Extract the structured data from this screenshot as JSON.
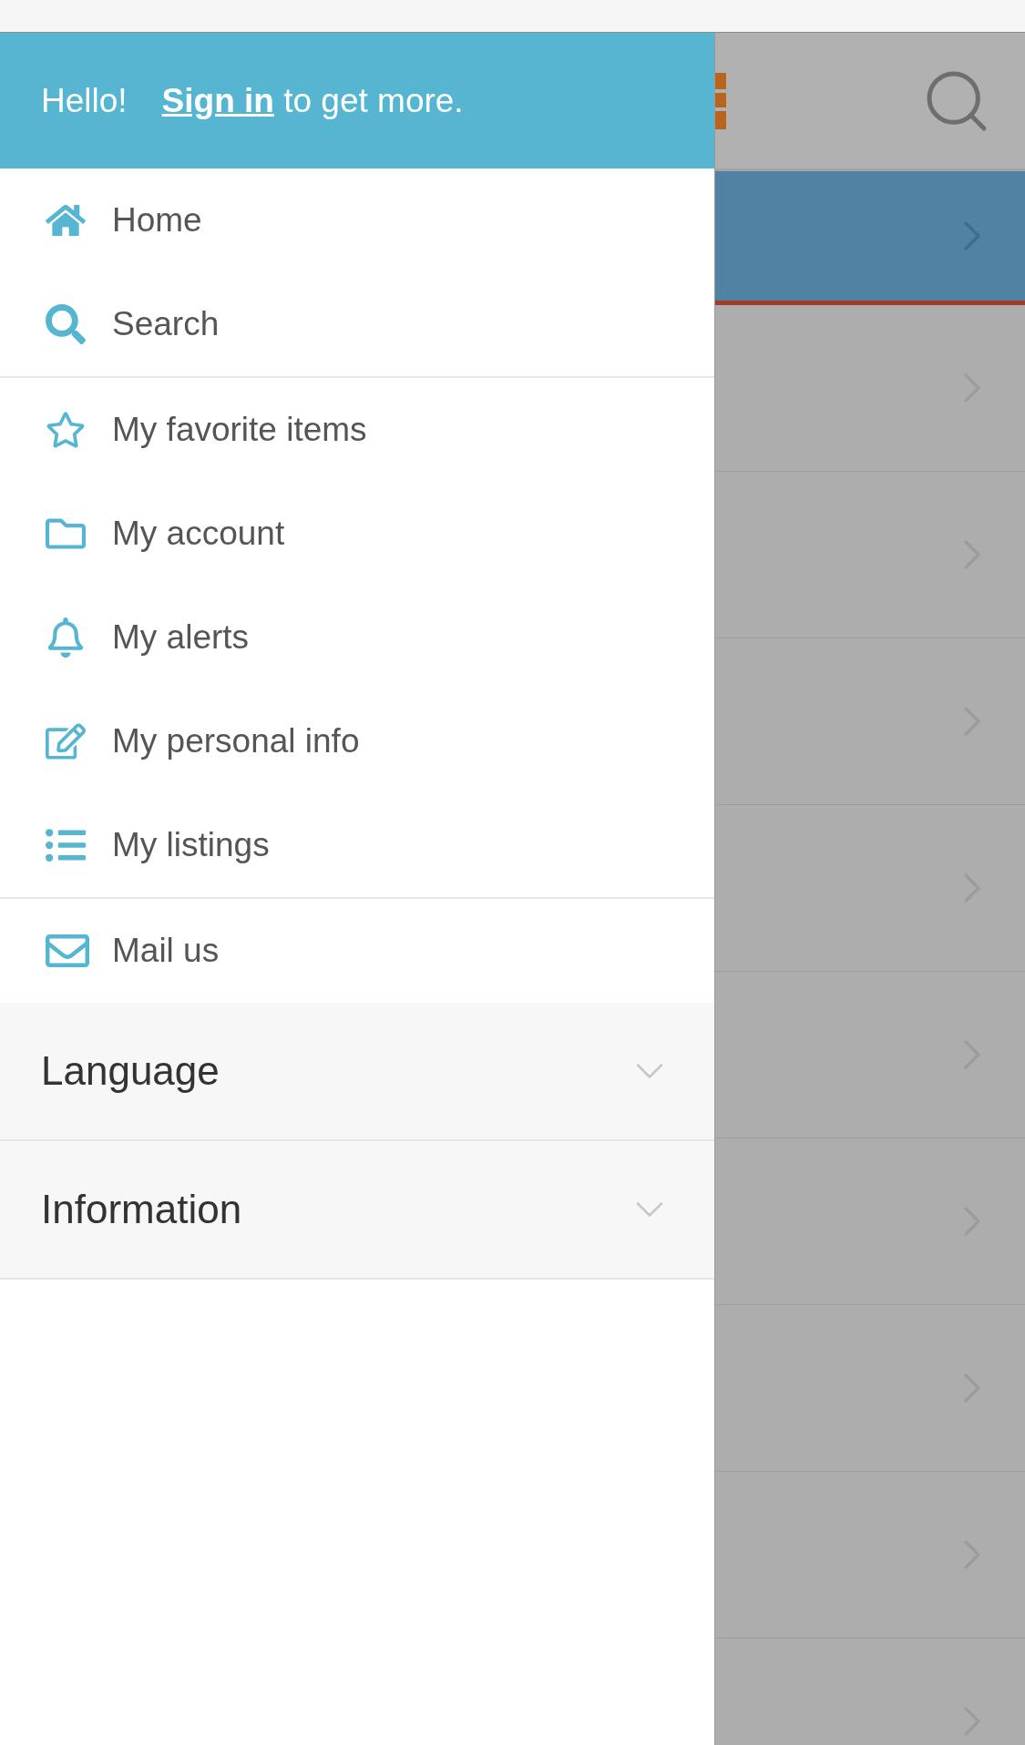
{
  "drawer": {
    "header": {
      "greeting": "Hello!",
      "link": "Sign in",
      "rest": "to get more."
    },
    "groups": [
      {
        "items": [
          {
            "kind": "home",
            "label": "Home"
          },
          {
            "kind": "search",
            "label": "Search"
          }
        ]
      },
      {
        "items": [
          {
            "kind": "star",
            "label": "My favorite items"
          },
          {
            "kind": "folder",
            "label": "My account"
          },
          {
            "kind": "bell",
            "label": "My alerts"
          },
          {
            "kind": "edit",
            "label": "My personal info"
          },
          {
            "kind": "list",
            "label": "My listings"
          }
        ]
      },
      {
        "items": [
          {
            "kind": "mail",
            "label": "Mail us"
          }
        ]
      }
    ],
    "sections": [
      {
        "label": "Language",
        "expanded": false
      },
      {
        "label": "Information",
        "expanded": false
      }
    ]
  },
  "background_list": {
    "rows": [
      {
        "selected": true
      },
      {
        "selected": false
      },
      {
        "selected": false
      },
      {
        "selected": false
      },
      {
        "selected": false
      },
      {
        "selected": false
      },
      {
        "selected": false
      },
      {
        "selected": false
      },
      {
        "selected": false
      },
      {
        "selected": false
      }
    ]
  }
}
